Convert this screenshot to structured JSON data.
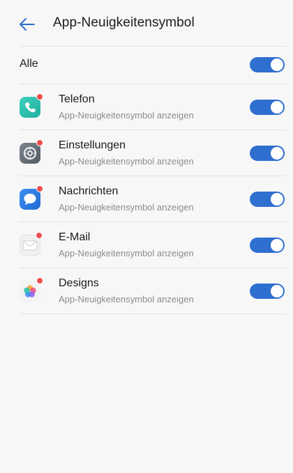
{
  "header": {
    "back_icon": "arrow-left-icon",
    "title": "App-Neuigkeitensymbol"
  },
  "all_row": {
    "label": "Alle",
    "enabled": true
  },
  "apps": [
    {
      "name": "Telefon",
      "subtitle": "App-Neuigkeitensymbol anzeigen",
      "icon": "phone-icon",
      "enabled": true
    },
    {
      "name": "Einstellungen",
      "subtitle": "App-Neuigkeitensymbol anzeigen",
      "icon": "settings-icon",
      "enabled": true
    },
    {
      "name": "Nachrichten",
      "subtitle": "App-Neuigkeitensymbol anzeigen",
      "icon": "messages-icon",
      "enabled": true
    },
    {
      "name": "E-Mail",
      "subtitle": "App-Neuigkeitensymbol anzeigen",
      "icon": "email-icon",
      "enabled": true
    },
    {
      "name": "Designs",
      "subtitle": "App-Neuigkeitensymbol anzeigen",
      "icon": "designs-icon",
      "enabled": true
    }
  ],
  "colors": {
    "accent": "#2f6fd0",
    "badge": "#f04e4e",
    "background": "#f7f7f7"
  }
}
